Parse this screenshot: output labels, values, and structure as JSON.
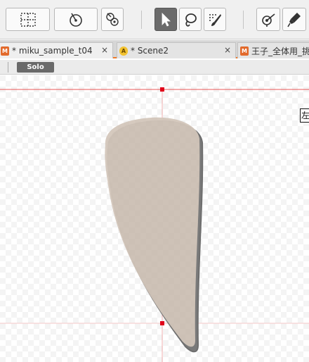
{
  "toolbar": {
    "buttons": [
      {
        "id": "warp-deformer",
        "icon": "warp-deformer-icon",
        "active": false
      },
      {
        "id": "rotation-deformer",
        "icon": "rotation-deformer-icon",
        "active": false
      },
      {
        "id": "glue",
        "icon": "glue-icon",
        "active": false
      },
      {
        "id": "arrow",
        "icon": "arrow-tool-icon",
        "active": true
      },
      {
        "id": "lasso",
        "icon": "lasso-tool-icon",
        "active": false
      },
      {
        "id": "brush",
        "icon": "brush-select-icon",
        "active": false
      },
      {
        "id": "mesh-edit",
        "icon": "mesh-edit-icon",
        "active": false
      },
      {
        "id": "pen",
        "icon": "pen-tool-icon",
        "active": false
      }
    ]
  },
  "tabs": [
    {
      "label": "* miku_sample_t04",
      "icon": "model-file-icon",
      "close": "×"
    },
    {
      "label": "* Scene2",
      "icon": "animation-scene-icon",
      "close": "×"
    },
    {
      "label": "王子_全体用_挑",
      "icon": "model-file-icon",
      "close": ""
    }
  ],
  "subbar": {
    "solo_label": "Solo"
  },
  "canvas": {
    "corner_label": "左",
    "guide_color": "#e83a3a",
    "shape_fill": "#c9b8aa",
    "shape_outline": "#6e6e6e"
  }
}
